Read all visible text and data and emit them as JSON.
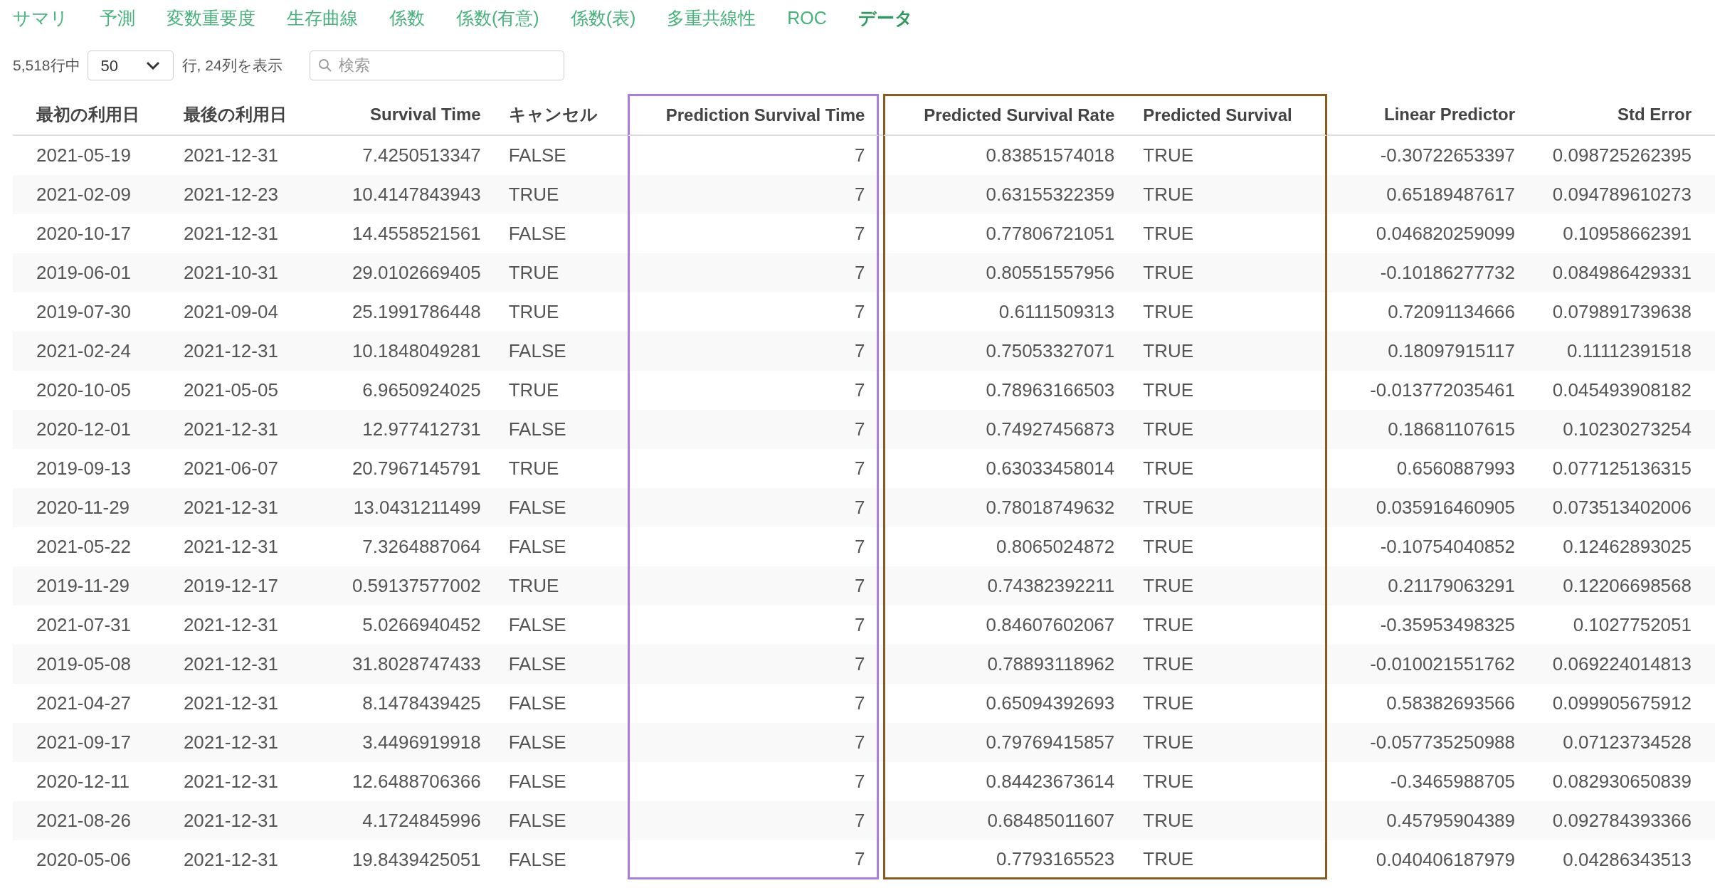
{
  "tabs": [
    {
      "label": "サマリ",
      "selected": false
    },
    {
      "label": "予測",
      "selected": false
    },
    {
      "label": "変数重要度",
      "selected": false
    },
    {
      "label": "生存曲線",
      "selected": false
    },
    {
      "label": "係数",
      "selected": false
    },
    {
      "label": "係数(有意)",
      "selected": false
    },
    {
      "label": "係数(表)",
      "selected": false
    },
    {
      "label": "多重共線性",
      "selected": false
    },
    {
      "label": "ROC",
      "selected": false
    },
    {
      "label": "データ",
      "selected": true
    }
  ],
  "controls": {
    "row_count": "5,518行中",
    "page_size": "50",
    "shown_text": "行, 24列を表示",
    "search": {
      "placeholder": "検索"
    }
  },
  "table": {
    "columns": [
      {
        "label": "最初の利用日",
        "kind": "text"
      },
      {
        "label": "最後の利用日",
        "kind": "text"
      },
      {
        "label": "Survival Time",
        "kind": "number"
      },
      {
        "label": "キャンセル",
        "kind": "text"
      },
      {
        "label": "Prediction Survival Time",
        "kind": "number",
        "color": "#a97ee0"
      },
      {
        "label": "Predicted Survival Rate",
        "kind": "number",
        "color": "#8b5a1e"
      },
      {
        "label": "Predicted Survival",
        "kind": "text",
        "color": "#8b5a1e"
      },
      {
        "label": "Linear Predictor",
        "kind": "number"
      },
      {
        "label": "Std Error",
        "kind": "number"
      }
    ],
    "rows": [
      [
        "2021-05-19",
        "2021-12-31",
        "7.4250513347",
        "FALSE",
        "7",
        "0.83851574018",
        "TRUE",
        "-0.30722653397",
        "0.098725262395"
      ],
      [
        "2021-02-09",
        "2021-12-23",
        "10.4147843943",
        "TRUE",
        "7",
        "0.63155322359",
        "TRUE",
        "0.65189487617",
        "0.094789610273"
      ],
      [
        "2020-10-17",
        "2021-12-31",
        "14.4558521561",
        "FALSE",
        "7",
        "0.77806721051",
        "TRUE",
        "0.046820259099",
        "0.10958662391"
      ],
      [
        "2019-06-01",
        "2021-10-31",
        "29.0102669405",
        "TRUE",
        "7",
        "0.80551557956",
        "TRUE",
        "-0.10186277732",
        "0.084986429331"
      ],
      [
        "2019-07-30",
        "2021-09-04",
        "25.1991786448",
        "TRUE",
        "7",
        "0.6111509313",
        "TRUE",
        "0.72091134666",
        "0.079891739638"
      ],
      [
        "2021-02-24",
        "2021-12-31",
        "10.1848049281",
        "FALSE",
        "7",
        "0.75053327071",
        "TRUE",
        "0.18097915117",
        "0.11112391518"
      ],
      [
        "2020-10-05",
        "2021-05-05",
        "6.9650924025",
        "TRUE",
        "7",
        "0.78963166503",
        "TRUE",
        "-0.013772035461",
        "0.045493908182"
      ],
      [
        "2020-12-01",
        "2021-12-31",
        "12.977412731",
        "FALSE",
        "7",
        "0.74927456873",
        "TRUE",
        "0.18681107615",
        "0.10230273254"
      ],
      [
        "2019-09-13",
        "2021-06-07",
        "20.7967145791",
        "TRUE",
        "7",
        "0.63033458014",
        "TRUE",
        "0.6560887993",
        "0.077125136315"
      ],
      [
        "2020-11-29",
        "2021-12-31",
        "13.0431211499",
        "FALSE",
        "7",
        "0.78018749632",
        "TRUE",
        "0.035916460905",
        "0.073513402006"
      ],
      [
        "2021-05-22",
        "2021-12-31",
        "7.3264887064",
        "FALSE",
        "7",
        "0.8065024872",
        "TRUE",
        "-0.10754040852",
        "0.12462893025"
      ],
      [
        "2019-11-29",
        "2019-12-17",
        "0.59137577002",
        "TRUE",
        "7",
        "0.74382392211",
        "TRUE",
        "0.21179063291",
        "0.12206698568"
      ],
      [
        "2021-07-31",
        "2021-12-31",
        "5.0266940452",
        "FALSE",
        "7",
        "0.84607602067",
        "TRUE",
        "-0.35953498325",
        "0.1027752051"
      ],
      [
        "2019-05-08",
        "2021-12-31",
        "31.8028747433",
        "FALSE",
        "7",
        "0.78893118962",
        "TRUE",
        "-0.010021551762",
        "0.069224014813"
      ],
      [
        "2021-04-27",
        "2021-12-31",
        "8.1478439425",
        "FALSE",
        "7",
        "0.65094392693",
        "TRUE",
        "0.58382693566",
        "0.099905675912"
      ],
      [
        "2021-09-17",
        "2021-12-31",
        "3.4496919918",
        "FALSE",
        "7",
        "0.79769415857",
        "TRUE",
        "-0.057735250988",
        "0.07123734528"
      ],
      [
        "2020-12-11",
        "2021-12-31",
        "12.6488706366",
        "FALSE",
        "7",
        "0.84423673614",
        "TRUE",
        "-0.3465988705",
        "0.082930650839"
      ],
      [
        "2021-08-26",
        "2021-12-31",
        "4.1724845996",
        "FALSE",
        "7",
        "0.68485011607",
        "TRUE",
        "0.45795904389",
        "0.092784393366"
      ],
      [
        "2020-05-06",
        "2021-12-31",
        "19.8439425051",
        "FALSE",
        "7",
        "0.7793165523",
        "TRUE",
        "0.040406187979",
        "0.04286343513"
      ]
    ]
  }
}
